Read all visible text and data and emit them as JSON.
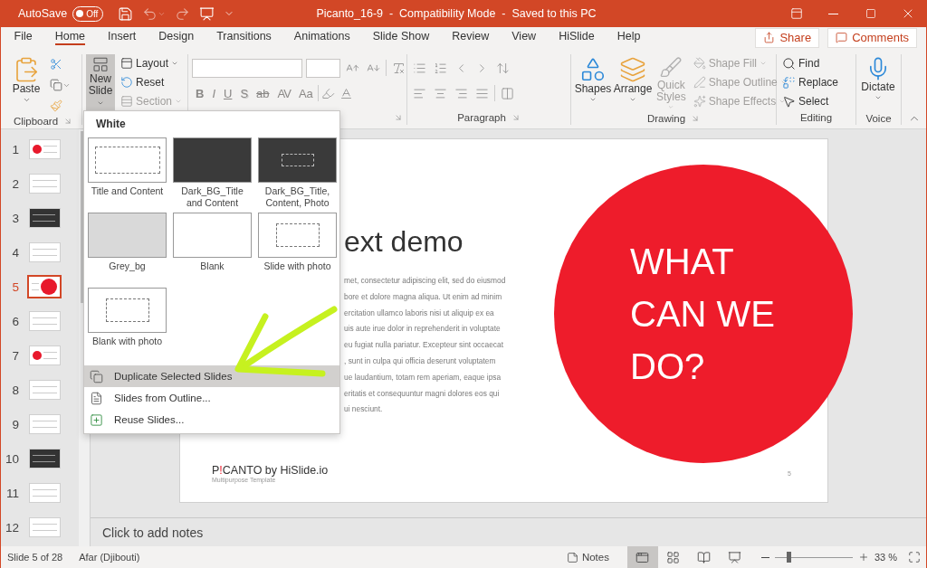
{
  "title_bar": {
    "autosave_label": "AutoSave",
    "autosave": {
      "on": false,
      "label": "Off"
    },
    "title": "Picanto_16-9  -  Compatibility Mode  -  Saved to this PC"
  },
  "tabs": [
    {
      "label": "File",
      "selected": false
    },
    {
      "label": "Home",
      "selected": true
    },
    {
      "label": "Insert",
      "selected": false
    },
    {
      "label": "Design",
      "selected": false
    },
    {
      "label": "Transitions",
      "selected": false
    },
    {
      "label": "Animations",
      "selected": false
    },
    {
      "label": "Slide Show",
      "selected": false
    },
    {
      "label": "Review",
      "selected": false
    },
    {
      "label": "View",
      "selected": false
    },
    {
      "label": "HiSlide",
      "selected": false
    },
    {
      "label": "Help",
      "selected": false
    }
  ],
  "share": "Share",
  "comments": "Comments",
  "ribbon": {
    "clipboard": {
      "label": "Clipboard",
      "paste": "Paste"
    },
    "slides": {
      "new_slide": "New Slide",
      "expanded": true,
      "items": [
        {
          "label": "Layout",
          "disabled": false
        },
        {
          "label": "Reset",
          "disabled": false
        },
        {
          "label": "Section",
          "disabled": true
        }
      ]
    },
    "font": {
      "buttons": [
        {
          "label": "B",
          "kind": "bold"
        },
        {
          "label": "I",
          "kind": "italic"
        },
        {
          "label": "U",
          "kind": "underline"
        },
        {
          "label": "S",
          "kind": "shadow"
        },
        {
          "label": "ab",
          "kind": "strike"
        },
        {
          "label": "AV",
          "kind": "spacing"
        },
        {
          "label": "Aa",
          "kind": "case"
        }
      ]
    },
    "paragraph": {
      "label": "Paragraph"
    },
    "drawing": {
      "label": "Drawing",
      "tools": [
        {
          "label": "Shapes",
          "kind": "shapes",
          "disabled": false
        },
        {
          "label": "Arrange",
          "kind": "arrange",
          "disabled": false
        },
        {
          "label": "Quick Styles",
          "kind": "styles",
          "disabled": true
        }
      ],
      "formats": [
        {
          "label": "Shape Fill",
          "kind": "fill",
          "disabled": true
        },
        {
          "label": "Shape Outline",
          "kind": "outline",
          "disabled": true
        },
        {
          "label": "Shape Effects",
          "kind": "effects",
          "disabled": true
        }
      ]
    },
    "editing": {
      "label": "Editing",
      "items": [
        {
          "label": "Find",
          "kind": "find"
        },
        {
          "label": "Replace",
          "kind": "replace"
        },
        {
          "label": "Select",
          "kind": "select"
        }
      ]
    },
    "voice": {
      "label": "Voice",
      "dictate": "Dictate"
    }
  },
  "thumbnails": [
    {
      "number": "1",
      "kind": "circle-left",
      "selected": false
    },
    {
      "number": "2",
      "kind": "text",
      "selected": false
    },
    {
      "number": "3",
      "kind": "dark",
      "selected": false
    },
    {
      "number": "4",
      "kind": "text",
      "selected": false
    },
    {
      "number": "5",
      "kind": "circle-right",
      "selected": true
    },
    {
      "number": "6",
      "kind": "text",
      "selected": false
    },
    {
      "number": "7",
      "kind": "circle-left",
      "selected": false
    },
    {
      "number": "8",
      "kind": "text",
      "selected": false
    },
    {
      "number": "9",
      "kind": "text",
      "selected": false
    },
    {
      "number": "10",
      "kind": "dark",
      "selected": false
    },
    {
      "number": "11",
      "kind": "text",
      "selected": false
    },
    {
      "number": "12",
      "kind": "text",
      "selected": false
    }
  ],
  "new_slide_menu": {
    "heading": "White",
    "layouts": [
      {
        "name": "Title and Content",
        "kind": "content"
      },
      {
        "name": "Dark_BG_Title and Content",
        "kind": "dark"
      },
      {
        "name": "Dark_BG_Title, Content, Photo",
        "kind": "dark-photo"
      },
      {
        "name": "Grey_bg",
        "kind": "grey"
      },
      {
        "name": "Blank",
        "kind": "blank"
      },
      {
        "name": "Slide with photo",
        "kind": "photo"
      },
      {
        "name": "Blank with photo",
        "kind": "photo"
      }
    ],
    "items": [
      {
        "label": "Duplicate Selected Slides",
        "kind": "duplicate",
        "selected": true
      },
      {
        "label": "Slides from Outline...",
        "kind": "outline",
        "selected": false
      },
      {
        "label": "Reuse Slides...",
        "kind": "reuse",
        "selected": false
      }
    ]
  },
  "slide": {
    "title": "ext demo",
    "body_lines": [
      "met, consectetur adipiscing elit, sed do eiusmod",
      "bore et dolore magna aliqua. Ut enim ad minim",
      "ercitation ullamco laboris nisi ut aliquip ex ea",
      "uis aute irue dolor in reprehenderit in voluptate",
      "eu fugiat nulla pariatur. Excepteur sint occaecat",
      ", sunt in culpa qui officia deserunt voluptatem",
      "ue laudantium, totam rem aperiam, eaque ipsa",
      "eritatis et consequuntur magni dolores eos qui",
      "ui nesciunt."
    ],
    "brand": {
      "lead": "P",
      "mark": "!",
      "rest": "CANTO by HiSlide.io"
    },
    "tagline": "Multipurpose Template",
    "page_number": "5",
    "callout": "WHAT CAN WE DO?"
  },
  "notes": {
    "placeholder": "Click to add notes"
  },
  "status_bar": {
    "slide_info": "Slide 5 of 28",
    "language": "Afar (Djibouti)",
    "notes": "Notes",
    "views": [
      {
        "kind": "normal",
        "selected": true
      },
      {
        "kind": "sorter",
        "selected": false
      },
      {
        "kind": "reading",
        "selected": false
      },
      {
        "kind": "slideshow",
        "selected": false
      }
    ],
    "zoom": {
      "level": 0.15,
      "reading": "33 %"
    }
  }
}
